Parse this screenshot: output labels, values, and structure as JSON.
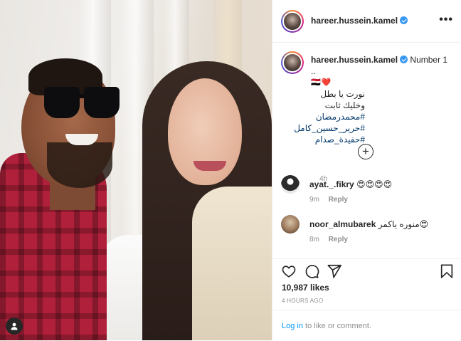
{
  "header": {
    "username": "hareer.hussein.kamel",
    "more_label": "•••"
  },
  "caption": {
    "username": "hareer.hussein.kamel",
    "text_first": "Number 1 ..",
    "emoji_line": "🇪🇬❤️",
    "arabic_line": "نورت يا بطل وخليك ثابت",
    "hashtags": [
      "#محمدرمضان",
      "#حرير_حسين_كامل",
      "#حفيدة_صدام"
    ],
    "time": "4h"
  },
  "load_more_label": "+",
  "comments": [
    {
      "username": "ayat._.fikry",
      "text": "😍😍😍😍",
      "time": "9m",
      "reply": "Reply"
    },
    {
      "username": "noor_almubarek",
      "text": "منوره ياكمر😍",
      "time": "8m",
      "reply": "Reply"
    }
  ],
  "stats": {
    "likes": "10,987 likes",
    "timestamp": "4 HOURS AGO"
  },
  "login": {
    "link": "Log in",
    "rest": " to like or comment."
  },
  "icons": [
    "heart-icon",
    "comment-icon",
    "share-icon",
    "bookmark-icon",
    "more-options-icon",
    "verified-badge-icon",
    "add-circle-icon",
    "user-tag-icon"
  ],
  "colors": {
    "link_blue": "#0095f6",
    "hashtag_blue": "#00376b",
    "verified_blue": "#3897f0",
    "secondary_text": "#8e8e8e",
    "primary_text": "#262626",
    "border": "#efefef"
  }
}
